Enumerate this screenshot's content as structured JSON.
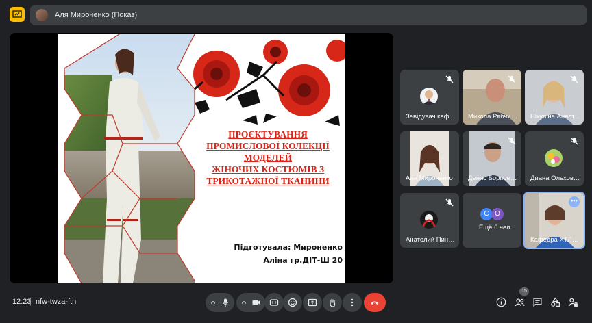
{
  "header": {
    "presenter_label": "Аля Мироненко (Показ)"
  },
  "slide": {
    "title_lines": [
      "ПРОЄКТУВАННЯ",
      "ПРОМИСЛОВОЇ КОЛЕКЦІЇ",
      "МОДЕЛЕЙ",
      "ЖІНОЧИХ КОСТЮМІВ З",
      "ТРИКОТАЖНОЇ ТКАНИНИ"
    ],
    "author_line1": "Підготувала: Мироненко",
    "author_line2": "Аліна гр.ДІТ-Ш 20"
  },
  "participants": [
    {
      "name": "Завідувач кафе...",
      "muted": true
    },
    {
      "name": "Микола Рябчик...",
      "muted": true
    },
    {
      "name": "Нікуліна Анаст...",
      "muted": true
    },
    {
      "name": "Аля Мироненко",
      "muted": false
    },
    {
      "name": "Денис Борисен...",
      "muted": true
    },
    {
      "name": "Диана Ольховс...",
      "muted": true
    },
    {
      "name": "Анатолий Пинс...",
      "muted": true
    },
    {
      "name": "Ещё 6 чел.",
      "muted": false,
      "avatars": [
        "С",
        "О"
      ]
    },
    {
      "name": "Кафедра ХТЛЛ...",
      "muted": false
    }
  ],
  "toolbar": {
    "time": "12:23",
    "separator": "|",
    "meeting_code": "nfw-twza-ftn",
    "participant_count": "15"
  },
  "colors": {
    "accent": "#8ab4f8",
    "end_call": "#ea4335",
    "present_badge": "#fbbc04",
    "slide_title": "#d92418"
  }
}
